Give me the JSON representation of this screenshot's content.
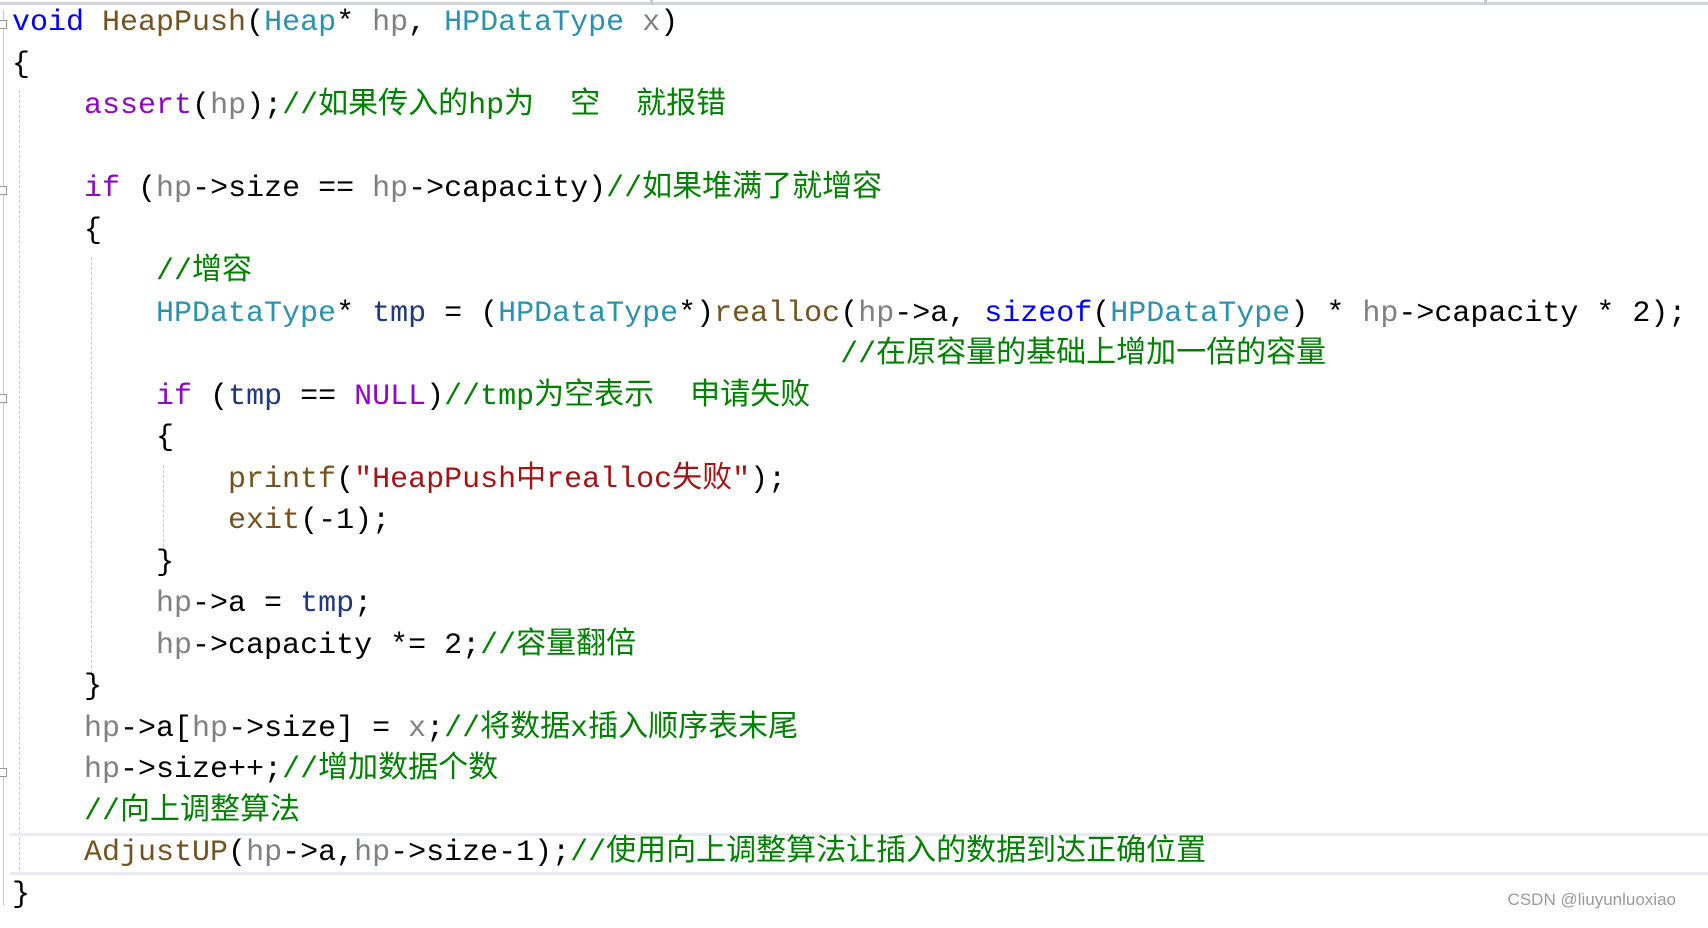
{
  "colors": {
    "keyword": "#0000ff",
    "function": "#74531f",
    "type": "#2b91af",
    "parameter": "#808080",
    "macro": "#8f08c4",
    "comment": "#008000",
    "string": "#a31515",
    "local": "#1f377f"
  },
  "code": {
    "lines": [
      [
        {
          "c": "kw",
          "t": "void"
        },
        {
          "c": "pl",
          "t": " "
        },
        {
          "c": "fn",
          "t": "HeapPush"
        },
        {
          "c": "pl",
          "t": "("
        },
        {
          "c": "ty",
          "t": "Heap"
        },
        {
          "c": "pl",
          "t": "* "
        },
        {
          "c": "pa",
          "t": "hp"
        },
        {
          "c": "pl",
          "t": ", "
        },
        {
          "c": "ty",
          "t": "HPDataType"
        },
        {
          "c": "pl",
          "t": " "
        },
        {
          "c": "pa",
          "t": "x"
        },
        {
          "c": "pl",
          "t": ")"
        }
      ],
      [
        {
          "c": "pl",
          "t": "{"
        }
      ],
      [
        {
          "c": "pl",
          "t": "    "
        },
        {
          "c": "mac",
          "t": "assert"
        },
        {
          "c": "pl",
          "t": "("
        },
        {
          "c": "pa",
          "t": "hp"
        },
        {
          "c": "pl",
          "t": ");"
        },
        {
          "c": "cm",
          "t": "//如果传入的hp为  空  就报错"
        }
      ],
      [],
      [
        {
          "c": "pl",
          "t": "    "
        },
        {
          "c": "mac",
          "t": "if"
        },
        {
          "c": "pl",
          "t": " ("
        },
        {
          "c": "pa",
          "t": "hp"
        },
        {
          "c": "pl",
          "t": "->size == "
        },
        {
          "c": "pa",
          "t": "hp"
        },
        {
          "c": "pl",
          "t": "->capacity)"
        },
        {
          "c": "cm",
          "t": "//如果堆满了就增容"
        }
      ],
      [
        {
          "c": "pl",
          "t": "    {"
        }
      ],
      [
        {
          "c": "pl",
          "t": "        "
        },
        {
          "c": "cm",
          "t": "//增容"
        }
      ],
      [
        {
          "c": "pl",
          "t": "        "
        },
        {
          "c": "ty",
          "t": "HPDataType"
        },
        {
          "c": "pl",
          "t": "* "
        },
        {
          "c": "lv",
          "t": "tmp"
        },
        {
          "c": "pl",
          "t": " = ("
        },
        {
          "c": "ty",
          "t": "HPDataType"
        },
        {
          "c": "pl",
          "t": "*)"
        },
        {
          "c": "fn",
          "t": "realloc"
        },
        {
          "c": "pl",
          "t": "("
        },
        {
          "c": "pa",
          "t": "hp"
        },
        {
          "c": "pl",
          "t": "->a, "
        },
        {
          "c": "kw",
          "t": "sizeof"
        },
        {
          "c": "pl",
          "t": "("
        },
        {
          "c": "ty",
          "t": "HPDataType"
        },
        {
          "c": "pl",
          "t": ") * "
        },
        {
          "c": "pa",
          "t": "hp"
        },
        {
          "c": "pl",
          "t": "->capacity * 2);"
        }
      ],
      [
        {
          "c": "pl",
          "t": "                                              "
        },
        {
          "c": "cm",
          "t": "//在原容量的基础上增加一倍的容量"
        }
      ],
      [
        {
          "c": "pl",
          "t": "        "
        },
        {
          "c": "mac",
          "t": "if"
        },
        {
          "c": "pl",
          "t": " ("
        },
        {
          "c": "lv",
          "t": "tmp"
        },
        {
          "c": "pl",
          "t": " == "
        },
        {
          "c": "mac",
          "t": "NULL"
        },
        {
          "c": "pl",
          "t": ")"
        },
        {
          "c": "cm",
          "t": "//tmp为空表示  申请失败"
        }
      ],
      [
        {
          "c": "pl",
          "t": "        {"
        }
      ],
      [
        {
          "c": "pl",
          "t": "            "
        },
        {
          "c": "fn",
          "t": "printf"
        },
        {
          "c": "pl",
          "t": "("
        },
        {
          "c": "str",
          "t": "\"HeapPush中realloc失败\""
        },
        {
          "c": "pl",
          "t": ");"
        }
      ],
      [
        {
          "c": "pl",
          "t": "            "
        },
        {
          "c": "fn",
          "t": "exit"
        },
        {
          "c": "pl",
          "t": "(-1);"
        }
      ],
      [
        {
          "c": "pl",
          "t": "        }"
        }
      ],
      [
        {
          "c": "pl",
          "t": "        "
        },
        {
          "c": "pa",
          "t": "hp"
        },
        {
          "c": "pl",
          "t": "->a = "
        },
        {
          "c": "lv",
          "t": "tmp"
        },
        {
          "c": "pl",
          "t": ";"
        }
      ],
      [
        {
          "c": "pl",
          "t": "        "
        },
        {
          "c": "pa",
          "t": "hp"
        },
        {
          "c": "pl",
          "t": "->capacity *= 2;"
        },
        {
          "c": "cm",
          "t": "//容量翻倍"
        }
      ],
      [
        {
          "c": "pl",
          "t": "    }"
        }
      ],
      [
        {
          "c": "pl",
          "t": "    "
        },
        {
          "c": "pa",
          "t": "hp"
        },
        {
          "c": "pl",
          "t": "->a["
        },
        {
          "c": "pa",
          "t": "hp"
        },
        {
          "c": "pl",
          "t": "->size] = "
        },
        {
          "c": "pa",
          "t": "x"
        },
        {
          "c": "pl",
          "t": ";"
        },
        {
          "c": "cm",
          "t": "//将数据x插入顺序表末尾"
        }
      ],
      [
        {
          "c": "pl",
          "t": "    "
        },
        {
          "c": "pa",
          "t": "hp"
        },
        {
          "c": "pl",
          "t": "->size++;"
        },
        {
          "c": "cm",
          "t": "//增加数据个数"
        }
      ],
      [
        {
          "c": "pl",
          "t": "    "
        },
        {
          "c": "cm",
          "t": "//向上调整算法"
        }
      ],
      [
        {
          "c": "pl",
          "t": "    "
        },
        {
          "c": "fn",
          "t": "AdjustUP"
        },
        {
          "c": "pl",
          "t": "("
        },
        {
          "c": "pa",
          "t": "hp"
        },
        {
          "c": "pl",
          "t": "->a,"
        },
        {
          "c": "pa",
          "t": "hp"
        },
        {
          "c": "pl",
          "t": "->size-1);"
        },
        {
          "c": "cm",
          "t": "//使用向上调整算法让插入的数据到达正确位置"
        }
      ],
      [
        {
          "c": "pl",
          "t": "}"
        }
      ]
    ]
  },
  "watermark": "CSDN @liuyunluoxiao"
}
